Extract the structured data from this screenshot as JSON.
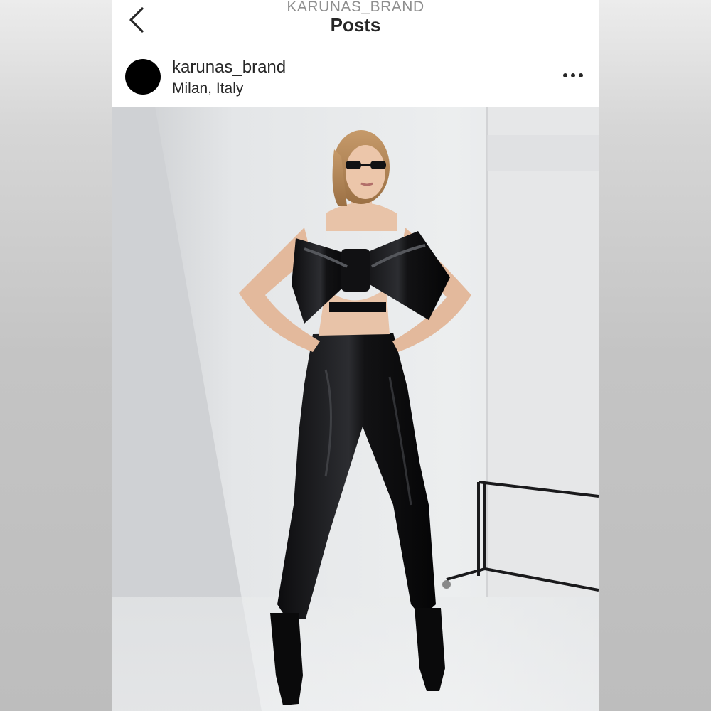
{
  "header": {
    "overline": "KARUNAS_BRAND",
    "title": "Posts",
    "back_icon": "chevron-left-icon"
  },
  "post": {
    "username": "karunas_brand",
    "location": "Milan, Italy",
    "more_icon": "more-horizontal-icon",
    "image_description_icon": "photo"
  },
  "colors": {
    "text_primary": "#262626",
    "text_secondary": "#8e8e8e",
    "avatar": "#000000"
  }
}
